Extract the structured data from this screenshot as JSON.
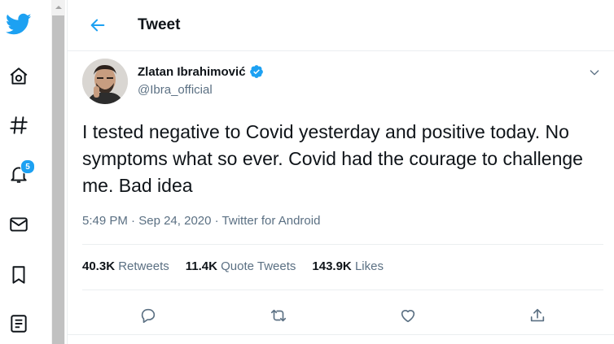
{
  "header": {
    "title": "Tweet"
  },
  "rail": {
    "notifications_badge": "5",
    "icons": [
      "twitter-bird-icon",
      "home-icon",
      "hashtag-icon",
      "bell-icon",
      "mail-icon",
      "bookmark-icon",
      "list-icon"
    ]
  },
  "tweet": {
    "author_name": "Zlatan Ibrahimović",
    "author_handle": "@Ibra_official",
    "verified": true,
    "text": "I tested negative to Covid yesterday and positive today. No symptoms what so ever. Covid had the courage to challenge me. Bad idea",
    "time": "5:49 PM",
    "date": "Sep 24, 2020",
    "source": "Twitter for Android",
    "meta_sep": " · ",
    "stats": {
      "retweets_count": "40.3K",
      "retweets_label": "Retweets",
      "quotes_count": "11.4K",
      "quotes_label": "Quote Tweets",
      "likes_count": "143.9K",
      "likes_label": "Likes"
    }
  },
  "colors": {
    "accent": "#1da1f2",
    "text_primary": "#0f1419",
    "text_secondary": "#5b7083",
    "divider": "#ebeef0"
  }
}
